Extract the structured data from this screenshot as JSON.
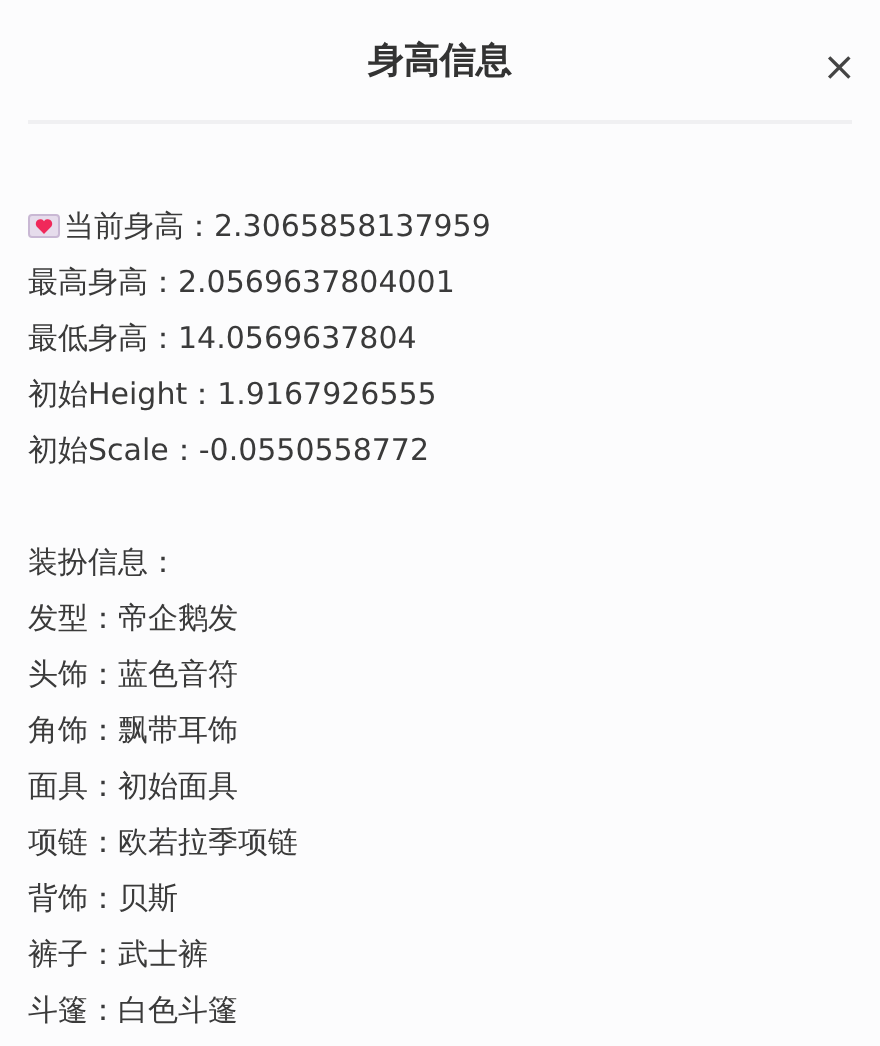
{
  "dialog": {
    "title": "身高信息",
    "close": "×"
  },
  "height_info": [
    "当前身高：2.3065858137959",
    "最高身高：2.0569637804001",
    "最低身高：14.0569637804",
    "初始Height：1.9167926555",
    "初始Scale：-0.0550558772"
  ],
  "outfit": {
    "heading": "装扮信息：",
    "items": [
      "发型：帝企鹅发",
      "头饰：蓝色音符",
      "角饰：飘带耳饰",
      "面具：初始面具",
      "项链：欧若拉季项链",
      "背饰：贝斯",
      "裤子：武士裤",
      "斗篷：白色斗篷"
    ]
  }
}
